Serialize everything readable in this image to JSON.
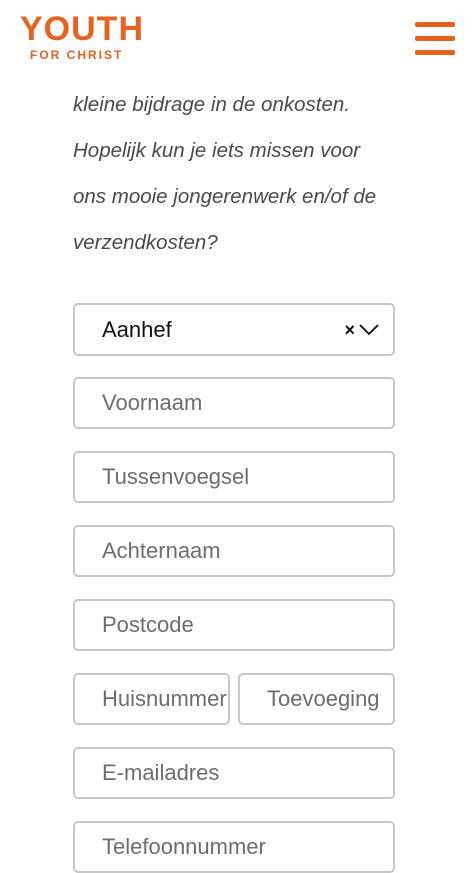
{
  "header": {
    "logo_main": "YOUTH",
    "logo_sub": "FOR CHRIST",
    "logo_color": "#e8611f",
    "menu_icon": "hamburger-menu-icon"
  },
  "intro": {
    "lines": [
      "kleine bijdrage in de onkosten.",
      "Hopelijk kun je iets missen voor",
      "ons mooie jongerenwerk en/of de",
      "verzendkosten?"
    ]
  },
  "form": {
    "salutation": {
      "value": "Aanhef",
      "clear_symbol": "×"
    },
    "first_name_placeholder": "Voornaam",
    "infix_placeholder": "Tussenvoegsel",
    "last_name_placeholder": "Achternaam",
    "postcode_placeholder": "Postcode",
    "house_number_placeholder": "Huisnummer",
    "addition_placeholder": "Toevoeging",
    "email_placeholder": "E-mailadres",
    "phone_placeholder": "Telefoonnummer"
  }
}
